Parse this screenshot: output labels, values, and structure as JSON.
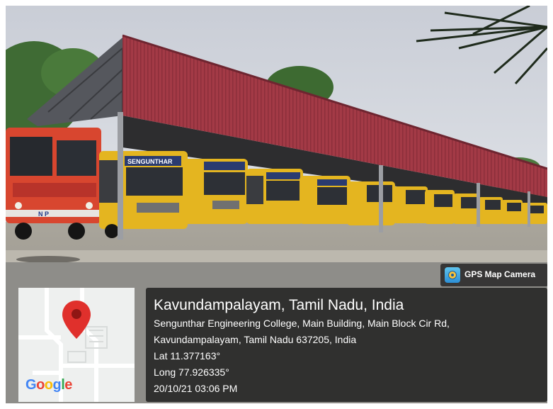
{
  "camera_badge": {
    "label": "GPS Map Camera",
    "icon": "camera-icon"
  },
  "map": {
    "brand": "Google",
    "pin": "location-pin-icon"
  },
  "location": {
    "title": "Kavundampalayam, Tamil Nadu, India",
    "address_line1": "Sengunthar Engineering College, Main Building, Main Block Cir Rd,",
    "address_line2": "Kavundampalayam, Tamil Nadu 637205, India",
    "lat": "Lat 11.377163°",
    "long": "Long 77.926335°",
    "datetime": "20/10/21 03:06 PM"
  },
  "bus_signs": {
    "front_bus": "SENGUNTHAR",
    "plate": "N   P"
  },
  "colors": {
    "shed_roof": "#a33a46",
    "bus_yellow": "#e4b520",
    "bus_red": "#d8462f",
    "overlay": "#1e1e1e",
    "pin_red": "#e0302c"
  }
}
